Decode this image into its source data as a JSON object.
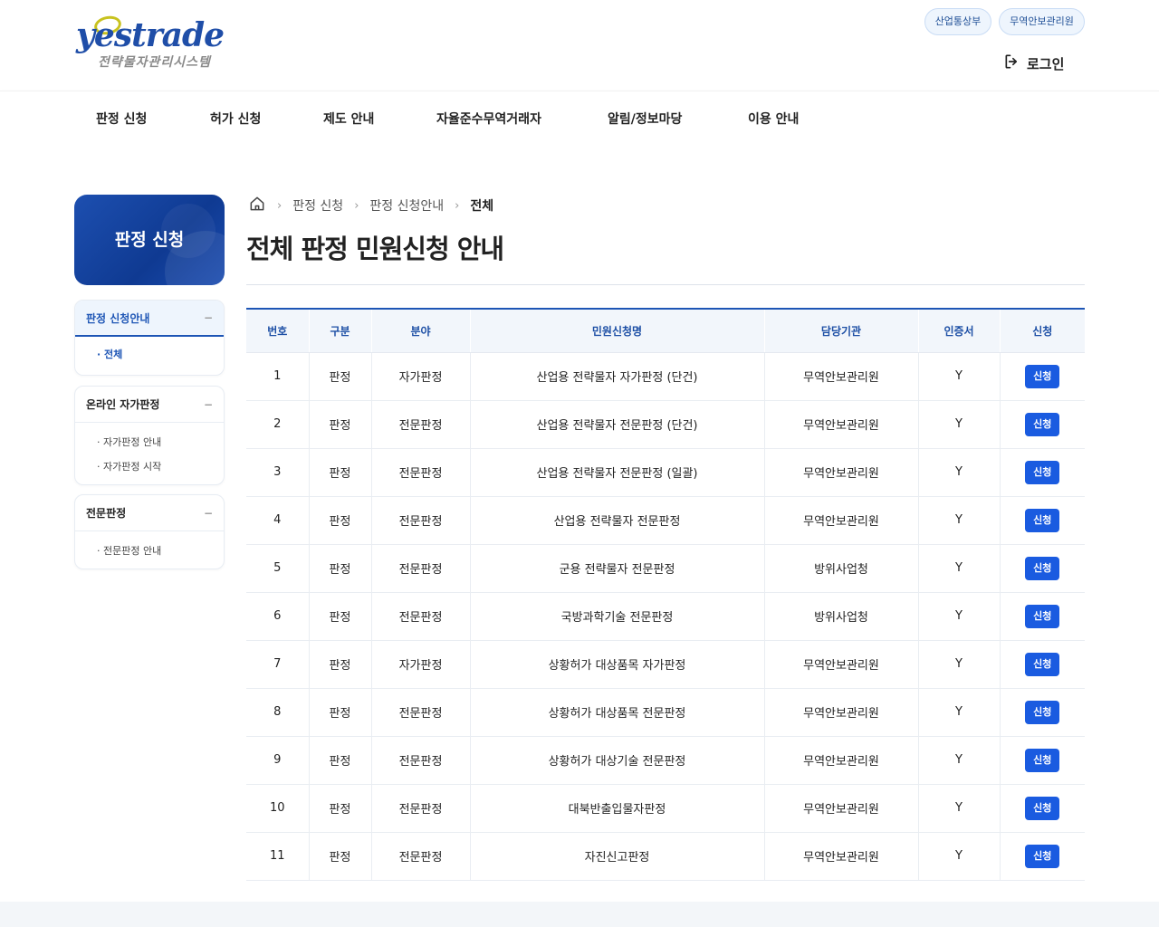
{
  "logo": {
    "word": "yestrade",
    "sub": "전략물자관리시스템"
  },
  "header": {
    "agencies": [
      "산업통상부",
      "무역안보관리원"
    ],
    "login": "로그인"
  },
  "gnb": [
    "판정 신청",
    "허가 신청",
    "제도 안내",
    "자율준수무역거래자",
    "알림/정보마당",
    "이용 안내"
  ],
  "sidebar": {
    "title": "판정 신청",
    "groups": [
      {
        "label": "판정 신청안내",
        "toggle": "−",
        "items": [
          "· 전체"
        ]
      },
      {
        "label": "온라인 자가판정",
        "toggle": "−",
        "items": [
          "· 자가판정 안내",
          "· 자가판정 시작"
        ]
      },
      {
        "label": "전문판정",
        "toggle": "−",
        "items": [
          "· 전문판정 안내"
        ]
      }
    ]
  },
  "breadcrumb": [
    "판정 신청",
    "판정 신청안내",
    "전체"
  ],
  "page_title": "전체 판정 민원신청 안내",
  "table": {
    "headers": [
      "번호",
      "구분",
      "분야",
      "민원신청명",
      "담당기관",
      "인증서",
      "신청"
    ],
    "button_label": "신청",
    "rows": [
      [
        "1",
        "판정",
        "자가판정",
        "산업용 전략물자 자가판정 (단건)",
        "무역안보관리원",
        "Y"
      ],
      [
        "2",
        "판정",
        "전문판정",
        "산업용 전략물자 전문판정 (단건)",
        "무역안보관리원",
        "Y"
      ],
      [
        "3",
        "판정",
        "전문판정",
        "산업용 전략물자 전문판정 (일괄)",
        "무역안보관리원",
        "Y"
      ],
      [
        "4",
        "판정",
        "전문판정",
        "산업용 전략물자 전문판정",
        "무역안보관리원",
        "Y"
      ],
      [
        "5",
        "판정",
        "전문판정",
        "군용 전략물자 전문판정",
        "방위사업청",
        "Y"
      ],
      [
        "6",
        "판정",
        "전문판정",
        "국방과학기술 전문판정",
        "방위사업청",
        "Y"
      ],
      [
        "7",
        "판정",
        "자가판정",
        "상황허가 대상품목 자가판정",
        "무역안보관리원",
        "Y"
      ],
      [
        "8",
        "판정",
        "전문판정",
        "상황허가 대상품목 전문판정",
        "무역안보관리원",
        "Y"
      ],
      [
        "9",
        "판정",
        "전문판정",
        "상황허가 대상기술 전문판정",
        "무역안보관리원",
        "Y"
      ],
      [
        "10",
        "판정",
        "전문판정",
        "대북반출입물자판정",
        "무역안보관리원",
        "Y"
      ],
      [
        "11",
        "판정",
        "전문판정",
        "자진신고판정",
        "무역안보관리원",
        "Y"
      ]
    ]
  }
}
